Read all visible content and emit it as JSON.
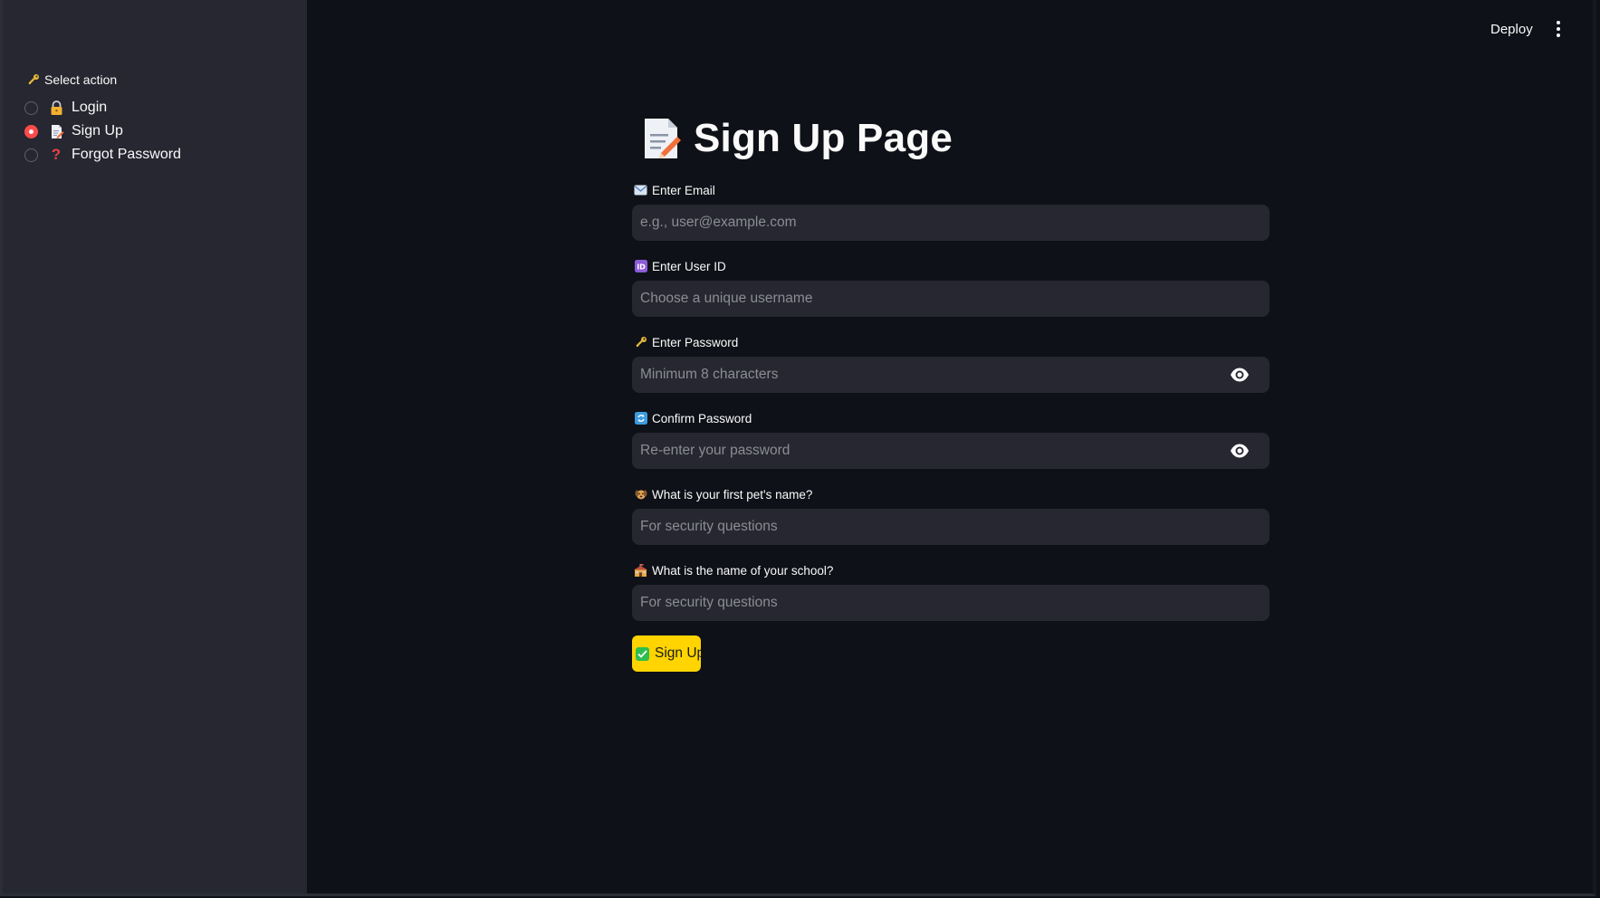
{
  "header": {
    "deploy_label": "Deploy"
  },
  "sidebar": {
    "label": "Select action",
    "label_icon": "key-icon",
    "options": [
      {
        "label": "Login",
        "icon": "lock-icon",
        "selected": false
      },
      {
        "label": "Sign Up",
        "icon": "memo-icon",
        "selected": true
      },
      {
        "label": "Forgot Password",
        "icon": "question-icon",
        "selected": false
      }
    ]
  },
  "main": {
    "title": "Sign Up Page",
    "title_icon": "memo-icon",
    "fields": [
      {
        "label": "Enter Email",
        "icon": "email-icon",
        "placeholder": "e.g., user@example.com",
        "type": "text",
        "has_eye": false
      },
      {
        "label": "Enter User ID",
        "icon": "id-icon",
        "placeholder": "Choose a unique username",
        "type": "text",
        "has_eye": false
      },
      {
        "label": "Enter Password",
        "icon": "key-icon",
        "placeholder": "Minimum 8 characters",
        "type": "password",
        "has_eye": true
      },
      {
        "label": "Confirm Password",
        "icon": "repeat-icon",
        "placeholder": "Re-enter your password",
        "type": "password",
        "has_eye": true
      },
      {
        "label": "What is your first pet's name?",
        "icon": "dog-icon",
        "placeholder": "For security questions",
        "type": "text",
        "has_eye": false
      },
      {
        "label": "What is the name of your school?",
        "icon": "school-icon",
        "placeholder": "For security questions",
        "type": "text",
        "has_eye": false
      }
    ],
    "submit_label": "Sign Up",
    "submit_icon": "check-icon"
  },
  "colors": {
    "background": "#0e1117",
    "sidebar": "#262730",
    "input": "#262730",
    "radio_selected": "#ff4b4b",
    "button": "#ffd400",
    "check": "#2dbe4f"
  }
}
